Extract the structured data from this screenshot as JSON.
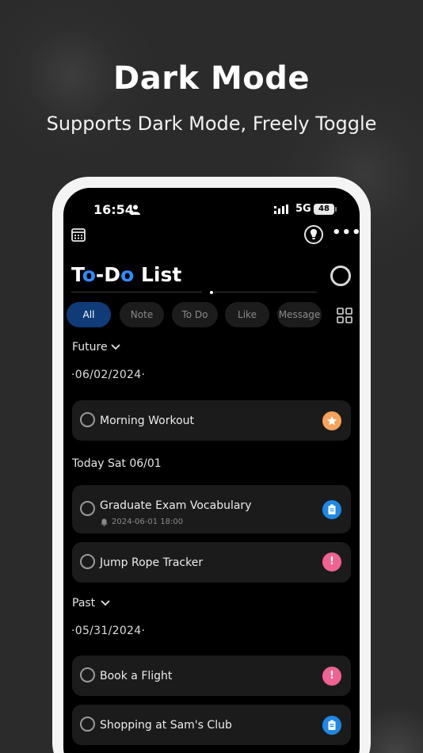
{
  "hero": {
    "title": "Dark Mode",
    "subtitle": "Supports Dark Mode, Freely Toggle"
  },
  "status_bar": {
    "time": "16:54",
    "network": "5G",
    "battery": "48"
  },
  "app": {
    "title_prefix": "T",
    "title_o1": "o",
    "title_mid": "-D",
    "title_o2": "o",
    "title_suffix": " List",
    "accent_color": "#2f8cff"
  },
  "tabs": [
    {
      "label": "All",
      "active": true
    },
    {
      "label": "Note",
      "active": false
    },
    {
      "label": "To Do",
      "active": false
    },
    {
      "label": "Like",
      "active": false
    },
    {
      "label": "Message",
      "active": false
    }
  ],
  "sections": {
    "future": {
      "label": "Future",
      "date": "·06/02/2024·",
      "items": [
        {
          "title": "Morning Workout",
          "badge": "star",
          "badge_color": "#f7a35c"
        }
      ]
    },
    "today": {
      "label": "Today Sat 06/01",
      "items": [
        {
          "title": "Graduate Exam Vocabulary",
          "reminder": "2024-06-01 18:00",
          "badge": "clipboard",
          "badge_color": "#1e88e5"
        },
        {
          "title": "Jump Rope Tracker",
          "badge": "!",
          "badge_color": "#f06292"
        }
      ]
    },
    "past": {
      "label": "Past",
      "date": "·05/31/2024·",
      "items": [
        {
          "title": "Book a Flight",
          "badge": "!",
          "badge_color": "#f06292"
        },
        {
          "title": "Shopping at Sam's Club",
          "badge": "clipboard",
          "badge_color": "#1e88e5"
        }
      ]
    }
  }
}
